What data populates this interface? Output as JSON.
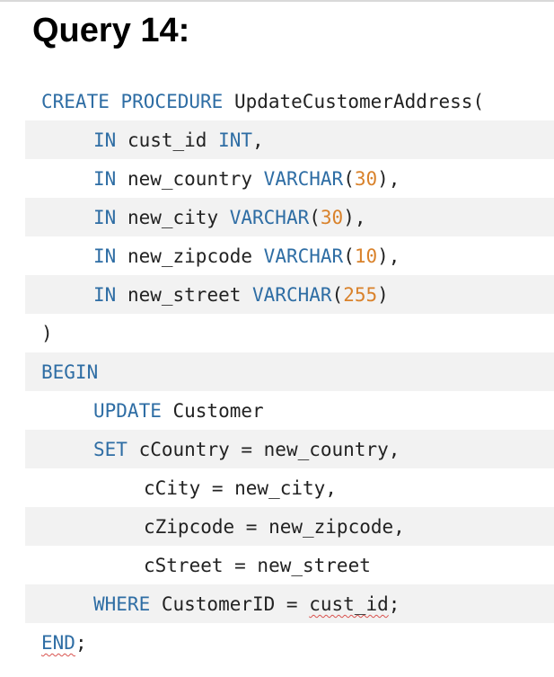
{
  "heading": "Query 14:",
  "code": {
    "line1": {
      "kw1": "CREATE PROCEDURE",
      "text1": " UpdateCustomerAddress("
    },
    "line2": {
      "kw1": "IN",
      "text1": " cust_id ",
      "kw2": "INT",
      "text2": ","
    },
    "line3": {
      "kw1": "IN",
      "text1": " new_country ",
      "kw2": "VARCHAR",
      "text2": "(",
      "num": "30",
      "text3": "),"
    },
    "line4": {
      "kw1": "IN",
      "text1": " new_city ",
      "kw2": "VARCHAR",
      "text2": "(",
      "num": "30",
      "text3": "),"
    },
    "line5": {
      "kw1": "IN",
      "text1": " new_zipcode ",
      "kw2": "VARCHAR",
      "text2": "(",
      "num": "10",
      "text3": "),"
    },
    "line6": {
      "kw1": "IN",
      "text1": " new_street ",
      "kw2": "VARCHAR",
      "text2": "(",
      "num": "255",
      "text3": ")"
    },
    "line7": {
      "text1": ")"
    },
    "line8": {
      "kw1": "BEGIN"
    },
    "line9": {
      "kw1": "UPDATE",
      "text1": " Customer"
    },
    "line10": {
      "kw1": "SET",
      "text1": " cCountry = new_country,"
    },
    "line11": {
      "text1": "cCity = new_city,"
    },
    "line12": {
      "text1": "cZipcode = new_zipcode,"
    },
    "line13": {
      "text1": "cStreet = new_street"
    },
    "line14": {
      "kw1": "WHERE",
      "text1": " CustomerID = ",
      "squiggle": "cust_id",
      "text2": ";"
    },
    "line15": {
      "squiggle": "END",
      "text1": ";"
    }
  }
}
